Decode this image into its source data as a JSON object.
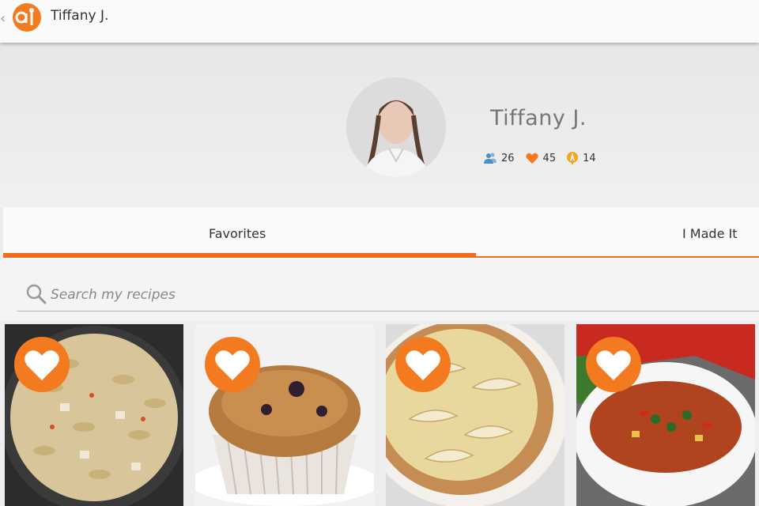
{
  "app": {
    "title": "Tiffany J."
  },
  "profile": {
    "name": "Tiffany J.",
    "stats": {
      "followers": "26",
      "favorites": "45",
      "made": "14"
    }
  },
  "tabs": [
    {
      "label": "Favorites",
      "active": true
    },
    {
      "label": "I Made It",
      "active": false
    }
  ],
  "search": {
    "placeholder": "Search my recipes",
    "value": ""
  },
  "recipes": [
    {
      "image": "pasta-salad",
      "favorited": true
    },
    {
      "image": "muffin",
      "favorited": true
    },
    {
      "image": "apple-tart",
      "favorited": true
    },
    {
      "image": "vegetable-soup",
      "favorited": true
    }
  ],
  "colors": {
    "accent": "#f47a1f",
    "tab_indicator": "#f26b1d",
    "stat_blue": "#4a90c8"
  }
}
